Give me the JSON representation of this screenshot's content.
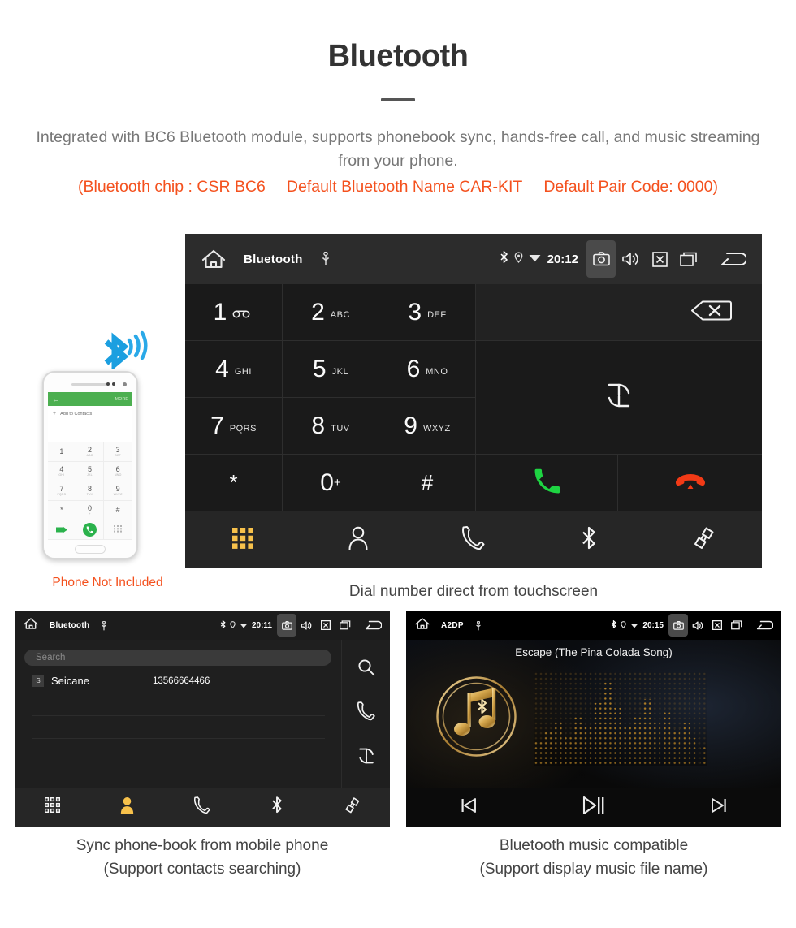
{
  "header": {
    "title": "Bluetooth",
    "description": "Integrated with BC6 Bluetooth module, supports phonebook sync, hands-free call, and music streaming from your phone.",
    "specs": [
      "(Bluetooth chip : CSR BC6",
      "Default Bluetooth Name CAR-KIT",
      "Default Pair Code: 0000)"
    ],
    "accent_color": "#f4511e",
    "text_color": "#777777"
  },
  "dialer_unit": {
    "statusbar": {
      "home_icon": "home-icon",
      "title": "Bluetooth",
      "usb_icon": "usb-icon",
      "bluetooth_icon": "bluetooth-icon",
      "location_icon": "location-icon",
      "wifi_icon": "wifi-icon",
      "time": "20:12",
      "camera_icon": "camera-icon",
      "volume_icon": "volume-icon",
      "close_icon": "close-box-icon",
      "recents_icon": "recents-icon",
      "back_icon": "back-arrow-icon"
    },
    "keys": [
      {
        "num": "1",
        "sub": "",
        "voicemail": true
      },
      {
        "num": "2",
        "sub": "ABC"
      },
      {
        "num": "3",
        "sub": "DEF"
      },
      {
        "num": "4",
        "sub": "GHI"
      },
      {
        "num": "5",
        "sub": "JKL"
      },
      {
        "num": "6",
        "sub": "MNO"
      },
      {
        "num": "7",
        "sub": "PQRS"
      },
      {
        "num": "8",
        "sub": "TUV"
      },
      {
        "num": "9",
        "sub": "WXYZ"
      },
      {
        "num": "*",
        "sub": ""
      },
      {
        "num": "0",
        "sup": "+"
      },
      {
        "num": "#",
        "sub": ""
      }
    ],
    "actions": {
      "backspace_icon": "backspace-icon",
      "sync_icon": "sync-icon",
      "call_icon": "call-icon",
      "hangup_icon": "hangup-icon",
      "call_color": "#1ed442",
      "hangup_color": "#f23a16"
    },
    "bottom_nav": [
      {
        "icon": "dialpad-icon",
        "active": true
      },
      {
        "icon": "contacts-icon",
        "active": false
      },
      {
        "icon": "call-log-icon",
        "active": false
      },
      {
        "icon": "bluetooth-icon",
        "active": false
      },
      {
        "icon": "pair-link-icon",
        "active": false
      }
    ],
    "active_color": "#f7c14b",
    "caption": "Dial number direct from touchscreen"
  },
  "phone_mockup": {
    "appbar_back_icon": "back-arrow-icon",
    "appbar_more_label": "MORE",
    "add_to_contacts_label": "Add to Contacts",
    "add_icon": "plus-icon",
    "keys": [
      {
        "num": "1",
        "sub": ""
      },
      {
        "num": "2",
        "sub": "ABC"
      },
      {
        "num": "3",
        "sub": "DEF"
      },
      {
        "num": "4",
        "sub": "GHI"
      },
      {
        "num": "5",
        "sub": "JKL"
      },
      {
        "num": "6",
        "sub": "MNO"
      },
      {
        "num": "7",
        "sub": "PQRS"
      },
      {
        "num": "8",
        "sub": "TUV"
      },
      {
        "num": "9",
        "sub": "WXYZ"
      },
      {
        "num": "*",
        "sub": ""
      },
      {
        "num": "0",
        "sub": "+"
      },
      {
        "num": "#",
        "sub": ""
      }
    ],
    "call_icon": "call-icon",
    "hide_icon": "hide-keypad-icon",
    "keypad_icon": "dialpad-icon",
    "not_included_label": "Phone Not Included",
    "bluetooth_wave_icon": "bluetooth-wave-icon"
  },
  "phonebook_unit": {
    "statusbar": {
      "title": "Bluetooth",
      "time": "20:11"
    },
    "search_placeholder": "Search",
    "contacts": [
      {
        "initial": "S",
        "name": "Seicane",
        "number": "13566664466"
      }
    ],
    "side_actions": [
      {
        "icon": "search-icon"
      },
      {
        "icon": "call-icon"
      },
      {
        "icon": "sync-icon"
      }
    ],
    "bottom_nav": [
      {
        "icon": "dialpad-icon",
        "active": false
      },
      {
        "icon": "contacts-icon",
        "active": true
      },
      {
        "icon": "call-log-icon",
        "active": false
      },
      {
        "icon": "bluetooth-icon",
        "active": false
      },
      {
        "icon": "pair-link-icon",
        "active": false
      }
    ],
    "caption_line1": "Sync phone-book from mobile phone",
    "caption_line2": "(Support contacts searching)"
  },
  "music_unit": {
    "statusbar": {
      "title": "A2DP",
      "time": "20:15"
    },
    "song_title": "Escape (The Pina Colada Song)",
    "album_icon": "music-note-bluetooth-icon",
    "equalizer_icon": "equalizer-dots",
    "controls": [
      {
        "icon": "previous-track-icon"
      },
      {
        "icon": "play-pause-icon"
      },
      {
        "icon": "next-track-icon"
      }
    ],
    "accent_color": "#d4a24a",
    "caption_line1": "Bluetooth music compatible",
    "caption_line2": "(Support display music file name)"
  }
}
